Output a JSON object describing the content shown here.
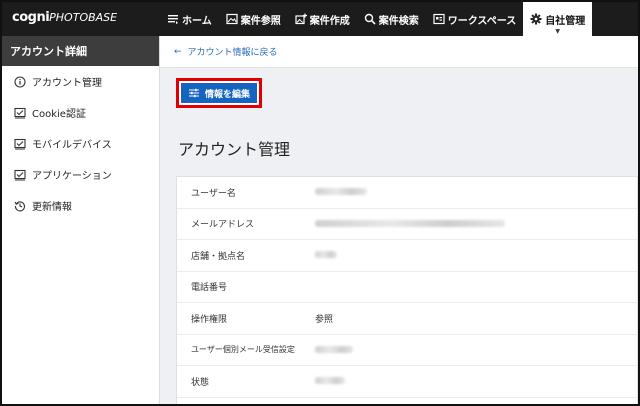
{
  "logo": {
    "part1": "cogni",
    "part2": "PHOTOBASE"
  },
  "nav": [
    {
      "label": "ホーム",
      "icon": "menu-lines-icon"
    },
    {
      "label": "案件参照",
      "icon": "image-icon"
    },
    {
      "label": "案件作成",
      "icon": "add-image-icon"
    },
    {
      "label": "案件検索",
      "icon": "search-icon"
    },
    {
      "label": "ワークスペース",
      "icon": "workspace-icon"
    },
    {
      "label": "自社管理",
      "icon": "gear-icon",
      "active": true
    }
  ],
  "sidebar": {
    "header": "アカウント詳細",
    "items": [
      {
        "label": "アカウント管理",
        "icon": "info-icon"
      },
      {
        "label": "Cookie認証",
        "icon": "checkbox-icon"
      },
      {
        "label": "モバイルデバイス",
        "icon": "checkbox-icon"
      },
      {
        "label": "アプリケーション",
        "icon": "checkbox-icon"
      },
      {
        "label": "更新情報",
        "icon": "history-icon"
      }
    ]
  },
  "breadcrumb": {
    "back_label": "アカウント情報に戻る"
  },
  "edit_button": {
    "label": "情報を編集"
  },
  "page_title": "アカウント管理",
  "fields": [
    {
      "label": "ユーザー名",
      "value": "",
      "blurred": true
    },
    {
      "label": "メールアドレス",
      "value": "",
      "blurred": true
    },
    {
      "label": "店舗・拠点名",
      "value": "",
      "blurred": true
    },
    {
      "label": "電話番号",
      "value": ""
    },
    {
      "label": "操作権限",
      "value": "参照"
    },
    {
      "label": "ユーザー個別メール受信設定",
      "value": "",
      "blurred": true
    },
    {
      "label": "状態",
      "value": "",
      "blurred": true
    }
  ],
  "colors": {
    "topbar": "#1c1c1c",
    "accent": "#1565c0",
    "highlight": "#e10000",
    "link": "#2a6ab8"
  }
}
